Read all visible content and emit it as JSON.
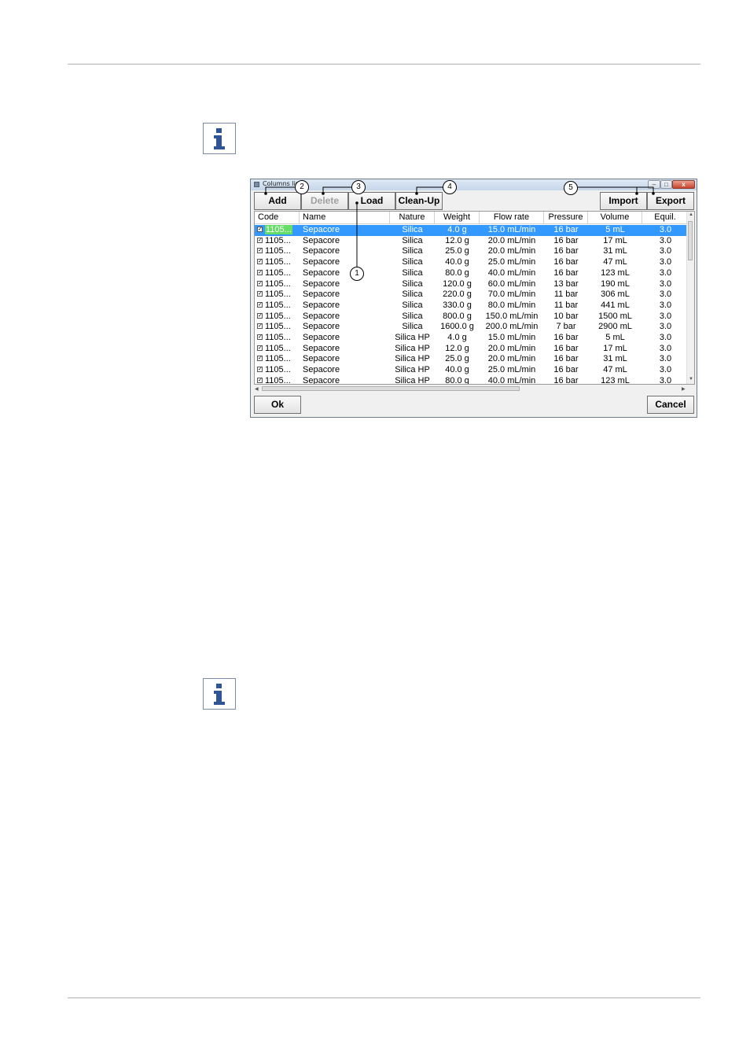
{
  "dialog": {
    "title": "Columns list",
    "toolbar": {
      "add": "Add",
      "delete": "Delete",
      "load": "Load",
      "cleanup": "Clean-Up",
      "import": "Import",
      "export": "Export"
    },
    "columns": [
      "Code",
      "Name",
      "Nature",
      "Weight",
      "Flow rate",
      "Pressure",
      "Volume",
      "Equil."
    ],
    "rows": [
      {
        "code": "1105...",
        "name": "Sepacore",
        "nature": "Silica",
        "weight": "4.0 g",
        "flow": "15.0 mL/min",
        "pressure": "16 bar",
        "volume": "5 mL",
        "equil": "3.0"
      },
      {
        "code": "1105...",
        "name": "Sepacore",
        "nature": "Silica",
        "weight": "12.0 g",
        "flow": "20.0 mL/min",
        "pressure": "16 bar",
        "volume": "17 mL",
        "equil": "3.0"
      },
      {
        "code": "1105...",
        "name": "Sepacore",
        "nature": "Silica",
        "weight": "25.0 g",
        "flow": "20.0 mL/min",
        "pressure": "16 bar",
        "volume": "31 mL",
        "equil": "3.0"
      },
      {
        "code": "1105...",
        "name": "Sepacore",
        "nature": "Silica",
        "weight": "40.0 g",
        "flow": "25.0 mL/min",
        "pressure": "16 bar",
        "volume": "47 mL",
        "equil": "3.0"
      },
      {
        "code": "1105...",
        "name": "Sepacore",
        "nature": "Silica",
        "weight": "80.0 g",
        "flow": "40.0 mL/min",
        "pressure": "16 bar",
        "volume": "123 mL",
        "equil": "3.0"
      },
      {
        "code": "1105...",
        "name": "Sepacore",
        "nature": "Silica",
        "weight": "120.0 g",
        "flow": "60.0 mL/min",
        "pressure": "13 bar",
        "volume": "190 mL",
        "equil": "3.0"
      },
      {
        "code": "1105...",
        "name": "Sepacore",
        "nature": "Silica",
        "weight": "220.0 g",
        "flow": "70.0 mL/min",
        "pressure": "11 bar",
        "volume": "306 mL",
        "equil": "3.0"
      },
      {
        "code": "1105...",
        "name": "Sepacore",
        "nature": "Silica",
        "weight": "330.0 g",
        "flow": "80.0 mL/min",
        "pressure": "11 bar",
        "volume": "441 mL",
        "equil": "3.0"
      },
      {
        "code": "1105...",
        "name": "Sepacore",
        "nature": "Silica",
        "weight": "800.0 g",
        "flow": "150.0 mL/min",
        "pressure": "10 bar",
        "volume": "1500 mL",
        "equil": "3.0"
      },
      {
        "code": "1105...",
        "name": "Sepacore",
        "nature": "Silica",
        "weight": "1600.0 g",
        "flow": "200.0 mL/min",
        "pressure": "7 bar",
        "volume": "2900 mL",
        "equil": "3.0"
      },
      {
        "code": "1105...",
        "name": "Sepacore",
        "nature": "Silica HP",
        "weight": "4.0 g",
        "flow": "15.0 mL/min",
        "pressure": "16 bar",
        "volume": "5 mL",
        "equil": "3.0"
      },
      {
        "code": "1105...",
        "name": "Sepacore",
        "nature": "Silica HP",
        "weight": "12.0 g",
        "flow": "20.0 mL/min",
        "pressure": "16 bar",
        "volume": "17 mL",
        "equil": "3.0"
      },
      {
        "code": "1105...",
        "name": "Sepacore",
        "nature": "Silica HP",
        "weight": "25.0 g",
        "flow": "20.0 mL/min",
        "pressure": "16 bar",
        "volume": "31 mL",
        "equil": "3.0"
      },
      {
        "code": "1105...",
        "name": "Sepacore",
        "nature": "Silica HP",
        "weight": "40.0 g",
        "flow": "25.0 mL/min",
        "pressure": "16 bar",
        "volume": "47 mL",
        "equil": "3.0"
      },
      {
        "code": "1105...",
        "name": "Sepacore",
        "nature": "Silica HP",
        "weight": "80.0 g",
        "flow": "40.0 mL/min",
        "pressure": "16 bar",
        "volume": "123 mL",
        "equil": "3.0"
      }
    ],
    "selected_row": 0,
    "footer": {
      "ok": "Ok",
      "cancel": "Cancel"
    }
  },
  "callouts": [
    "1",
    "2",
    "3",
    "4",
    "5"
  ],
  "colors": {
    "selection": "#3399ff",
    "code_highlight": "#66dd66",
    "info_icon": "#2f5597"
  },
  "icons": [
    "info-icon",
    "info-icon",
    "checkbox-icon",
    "minimize-icon",
    "maximize-icon",
    "close-icon"
  ]
}
